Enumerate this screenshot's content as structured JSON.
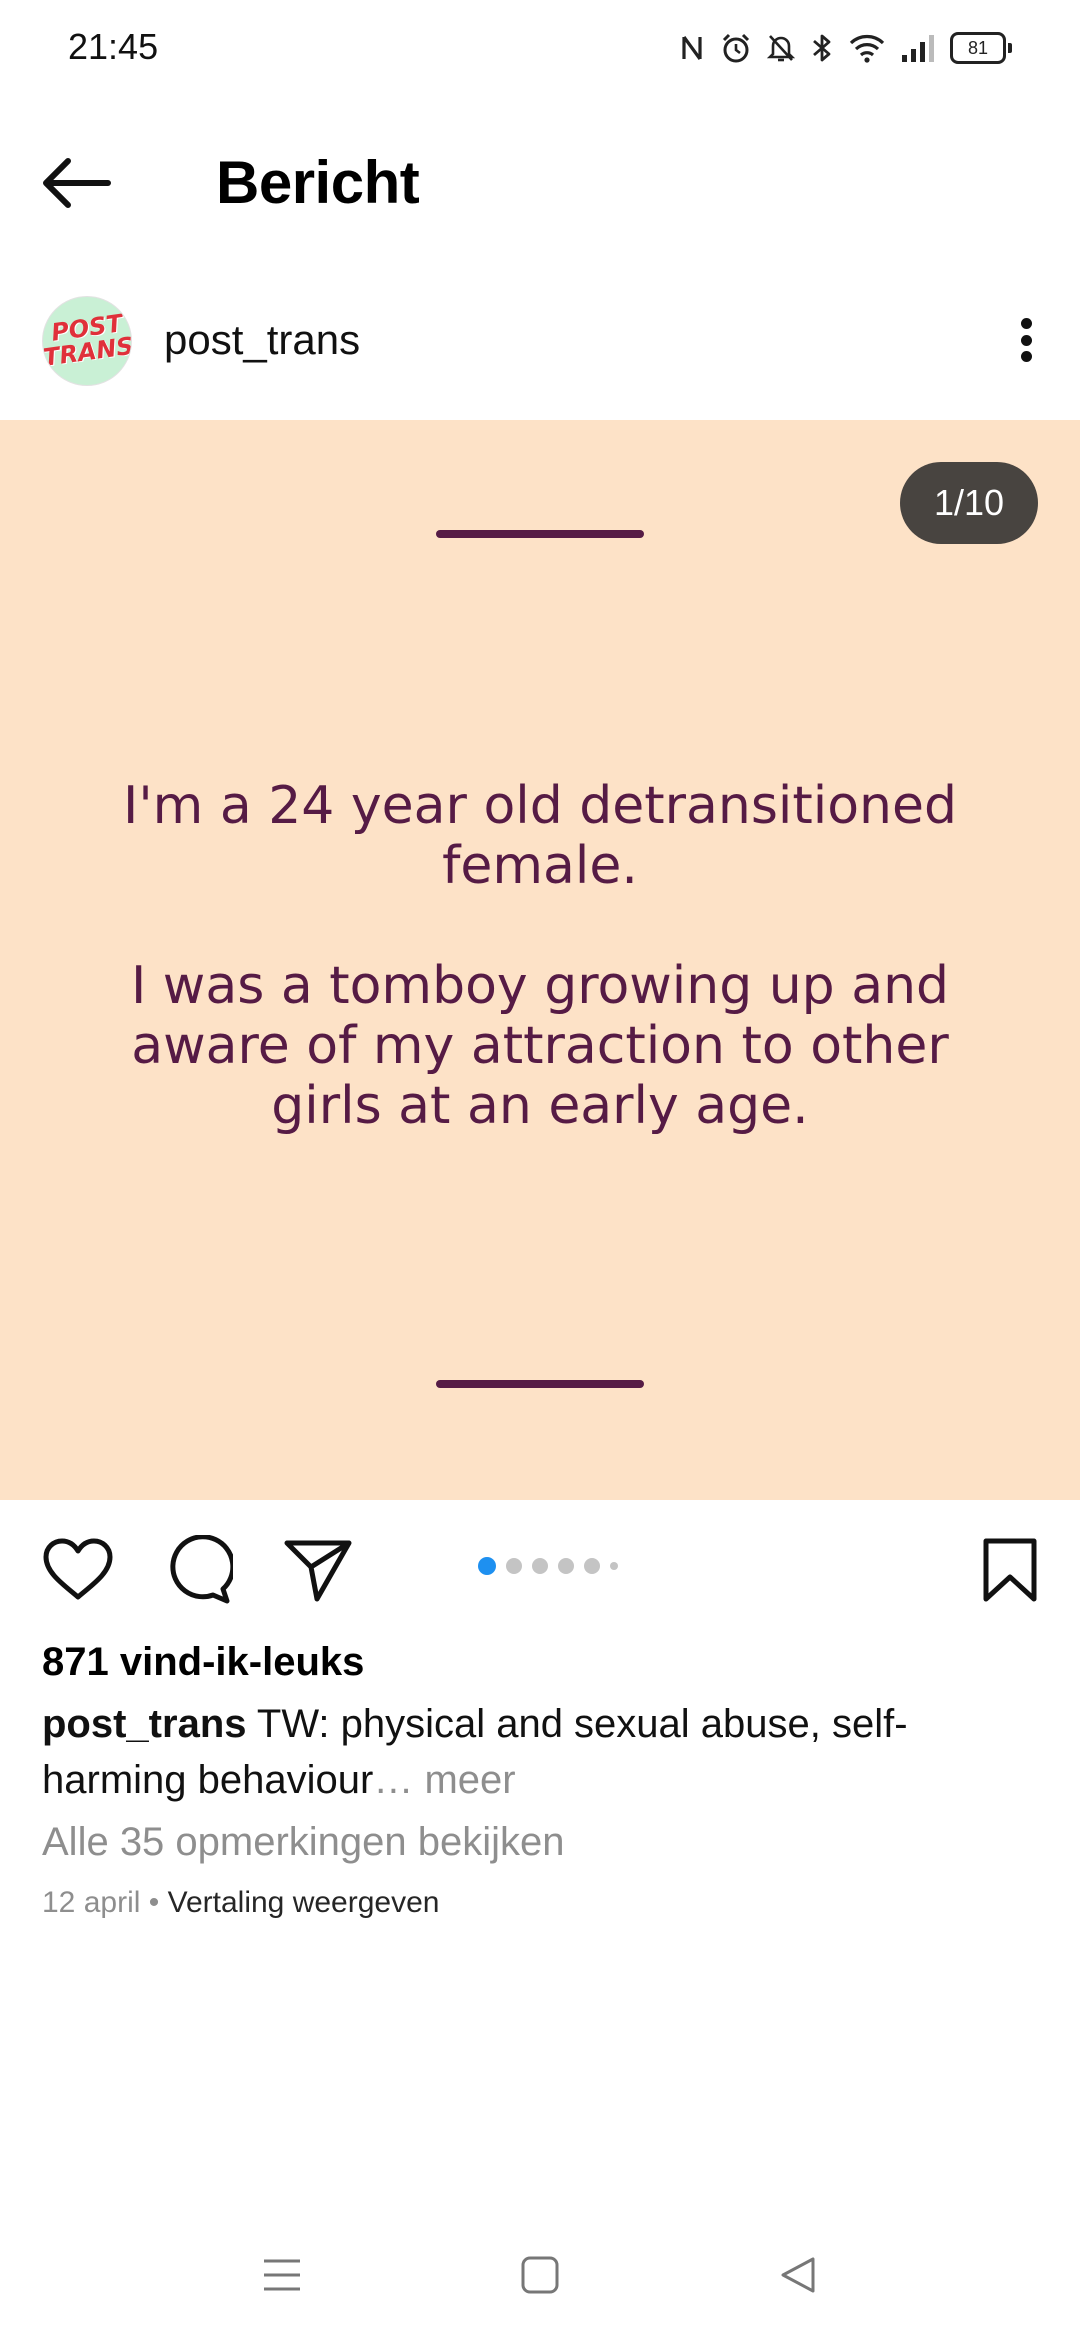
{
  "status_bar": {
    "time": "21:45",
    "icons": [
      "nfc-icon",
      "alarm-icon",
      "bell-off-icon",
      "bluetooth-icon",
      "wifi-icon",
      "signal-icon"
    ],
    "battery": "81"
  },
  "header": {
    "title": "Bericht",
    "back_icon": "arrow-left-icon"
  },
  "author": {
    "username": "post_trans",
    "avatar_text_line1": "POST",
    "avatar_text_line2": "TRANS",
    "menu_icon": "more-vertical-icon"
  },
  "post": {
    "background": "#fde2c7",
    "text_color": "#561b45",
    "page_counter": "1/10",
    "slide_text_1": "I'm a 24 year old detransitioned female.",
    "slide_text_2": "I was a tomboy growing up and aware of my attraction to other girls at an early age.",
    "carousel": {
      "current": 1,
      "visible_dots": 6
    }
  },
  "actions": {
    "like_icon": "heart-icon",
    "comment_icon": "comment-icon",
    "share_icon": "send-icon",
    "save_icon": "bookmark-icon",
    "accent_color": "#1e90f0"
  },
  "meta": {
    "likes": "871 vind-ik-leuks",
    "caption_user": "post_trans",
    "caption_text": "TW: physical and sexual abuse, self-harming behaviour",
    "caption_ellipsis": "…",
    "caption_more": "meer",
    "comments_link": "Alle 35 opmerkingen bekijken",
    "date": "12 april",
    "separator": "•",
    "translate": "Vertaling weergeven"
  },
  "nav_bar": {
    "menu_icon": "menu-icon",
    "home_icon": "home-square-icon",
    "back_icon": "back-triangle-icon"
  }
}
